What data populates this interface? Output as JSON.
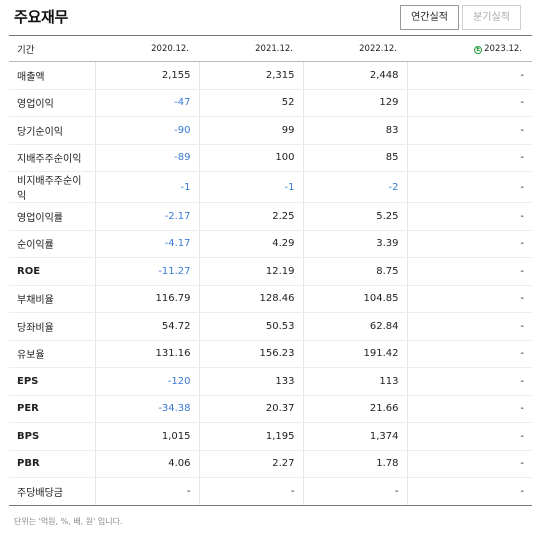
{
  "header": {
    "title": "주요재무",
    "tabs": [
      {
        "label": "연간실적",
        "active": true
      },
      {
        "label": "분기실적",
        "active": false
      }
    ]
  },
  "table": {
    "label_header": "기간",
    "columns": [
      "2020.12.",
      "2021.12.",
      "2022.12.",
      "2023.12."
    ],
    "estimate_badge": "E",
    "rows": [
      {
        "label": "매출액",
        "values": [
          "2,155",
          "2,315",
          "2,448",
          "-"
        ]
      },
      {
        "label": "영업이익",
        "values": [
          "-47",
          "52",
          "129",
          "-"
        ]
      },
      {
        "label": "당기순이익",
        "values": [
          "-90",
          "99",
          "83",
          "-"
        ]
      },
      {
        "label": "지배주주순이익",
        "values": [
          "-89",
          "100",
          "85",
          "-"
        ]
      },
      {
        "label": "비지배주주순이익",
        "values": [
          "-1",
          "-1",
          "-2",
          "-"
        ]
      },
      {
        "label": "영업이익률",
        "values": [
          "-2.17",
          "2.25",
          "5.25",
          "-"
        ]
      },
      {
        "label": "순이익률",
        "values": [
          "-4.17",
          "4.29",
          "3.39",
          "-"
        ]
      },
      {
        "label": "ROE",
        "values": [
          "-11.27",
          "12.19",
          "8.75",
          "-"
        ]
      },
      {
        "label": "부채비율",
        "values": [
          "116.79",
          "128.46",
          "104.85",
          "-"
        ]
      },
      {
        "label": "당좌비율",
        "values": [
          "54.72",
          "50.53",
          "62.84",
          "-"
        ]
      },
      {
        "label": "유보율",
        "values": [
          "131.16",
          "156.23",
          "191.42",
          "-"
        ]
      },
      {
        "label": "EPS",
        "values": [
          "-120",
          "133",
          "113",
          "-"
        ]
      },
      {
        "label": "PER",
        "values": [
          "-34.38",
          "20.37",
          "21.66",
          "-"
        ]
      },
      {
        "label": "BPS",
        "values": [
          "1,015",
          "1,195",
          "1,374",
          "-"
        ]
      },
      {
        "label": "PBR",
        "values": [
          "4.06",
          "2.27",
          "1.78",
          "-"
        ]
      },
      {
        "label": "주당배당금",
        "values": [
          "-",
          "-",
          "-",
          "-"
        ]
      }
    ]
  },
  "footnote": "단위는 '억원, %, 배, 원' 입니다.",
  "colors": {
    "negative": "#3a7bd5",
    "estimate_badge": "#2a9d3a"
  }
}
